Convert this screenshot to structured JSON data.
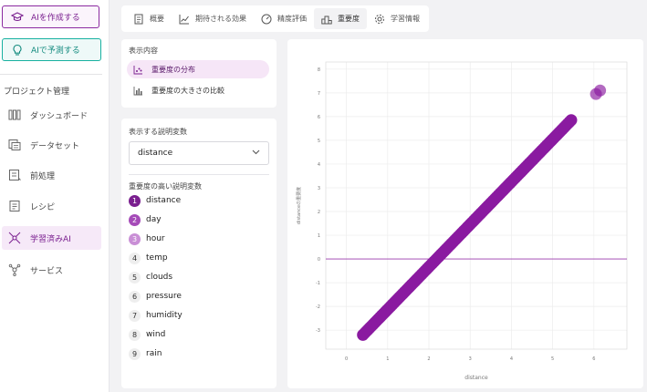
{
  "sidebar": {
    "create_label": "AIを作成する",
    "predict_label": "AIで予測する",
    "section_title": "プロジェクト管理",
    "items": [
      {
        "label": "ダッシュボード",
        "icon": "dashboard-icon"
      },
      {
        "label": "データセット",
        "icon": "dataset-icon"
      },
      {
        "label": "前処理",
        "icon": "preprocess-icon"
      },
      {
        "label": "レシピ",
        "icon": "recipe-icon"
      },
      {
        "label": "学習済みAI",
        "icon": "trained-ai-icon",
        "active": true
      },
      {
        "label": "サービス",
        "icon": "service-icon"
      }
    ]
  },
  "tabs": [
    {
      "label": "概要",
      "icon": "document-icon"
    },
    {
      "label": "期待される効果",
      "icon": "trend-icon"
    },
    {
      "label": "精度評価",
      "icon": "gauge-icon"
    },
    {
      "label": "重要度",
      "icon": "podium-icon",
      "active": true
    },
    {
      "label": "学習情報",
      "icon": "gear-icon"
    }
  ],
  "display": {
    "title": "表示内容",
    "options": [
      {
        "label": "重要度の分布",
        "active": true
      },
      {
        "label": "重要度の大きさの比較"
      }
    ]
  },
  "variables": {
    "select_title": "表示する説明変数",
    "selected": "distance",
    "ranking_title": "重要度の高い説明変数",
    "ranking": [
      "distance",
      "day",
      "hour",
      "temp",
      "clouds",
      "pressure",
      "humidity",
      "wind",
      "rain"
    ]
  },
  "colors": {
    "accent": "#7a1f8f",
    "point": "#8a1aa0",
    "teal": "#17b0a0"
  },
  "chart_data": {
    "type": "scatter",
    "xlabel": "distance",
    "ylabel": "distanceの重要度",
    "xlim": [
      -0.5,
      6.8
    ],
    "ylim": [
      -3.8,
      8.3
    ],
    "xticks": [
      0,
      1,
      2,
      3,
      4,
      5,
      6
    ],
    "yticks": [
      -3,
      -2,
      -1,
      0,
      1,
      2,
      3,
      4,
      5,
      6,
      7,
      8
    ],
    "reference_line_y": 0,
    "grid": true,
    "series": [
      {
        "x": [
          0.4,
          5.45
        ],
        "y": [
          -3.2,
          5.85
        ],
        "style": "dense-line"
      },
      {
        "x": [
          6.05,
          6.15
        ],
        "y": [
          6.95,
          7.1
        ],
        "style": "points"
      }
    ]
  }
}
